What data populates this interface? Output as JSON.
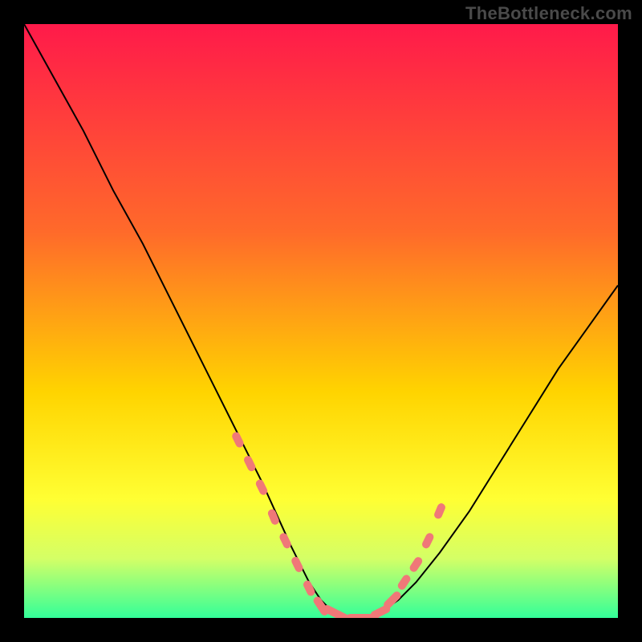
{
  "watermark": "TheBottleneck.com",
  "colors": {
    "bg_black": "#000000",
    "grad_top": "#ff1a4a",
    "grad_mid1": "#ff6a2a",
    "grad_mid2": "#ffd400",
    "grad_mid3": "#ffff33",
    "grad_bot1": "#d4ff66",
    "grad_bot2": "#33ff99",
    "stroke_curve": "#000000",
    "marker_fill": "#f07878",
    "marker_stroke": "#e05555"
  },
  "chart_data": {
    "type": "line",
    "title": "",
    "xlabel": "",
    "ylabel": "",
    "xlim": [
      0,
      100
    ],
    "ylim": [
      0,
      100
    ],
    "grid": false,
    "legend": false,
    "series": [
      {
        "name": "bottleneck-curve",
        "x": [
          0,
          5,
          10,
          15,
          20,
          25,
          30,
          35,
          40,
          45,
          48,
          50,
          52,
          55,
          58,
          60,
          63,
          66,
          70,
          75,
          80,
          85,
          90,
          95,
          100
        ],
        "y": [
          100,
          91,
          82,
          72,
          63,
          53,
          43,
          33,
          23,
          12,
          6,
          3,
          1,
          0,
          0,
          1,
          3,
          6,
          11,
          18,
          26,
          34,
          42,
          49,
          56
        ]
      }
    ],
    "markers": {
      "name": "highlight-points",
      "x": [
        36,
        38,
        40,
        42,
        44,
        46,
        48,
        50,
        52,
        54,
        56,
        58,
        60,
        62,
        64,
        66,
        68,
        70
      ],
      "y": [
        30,
        26,
        22,
        17,
        13,
        9,
        5,
        2,
        1,
        0,
        0,
        0,
        1,
        3,
        6,
        9,
        13,
        18
      ]
    }
  }
}
